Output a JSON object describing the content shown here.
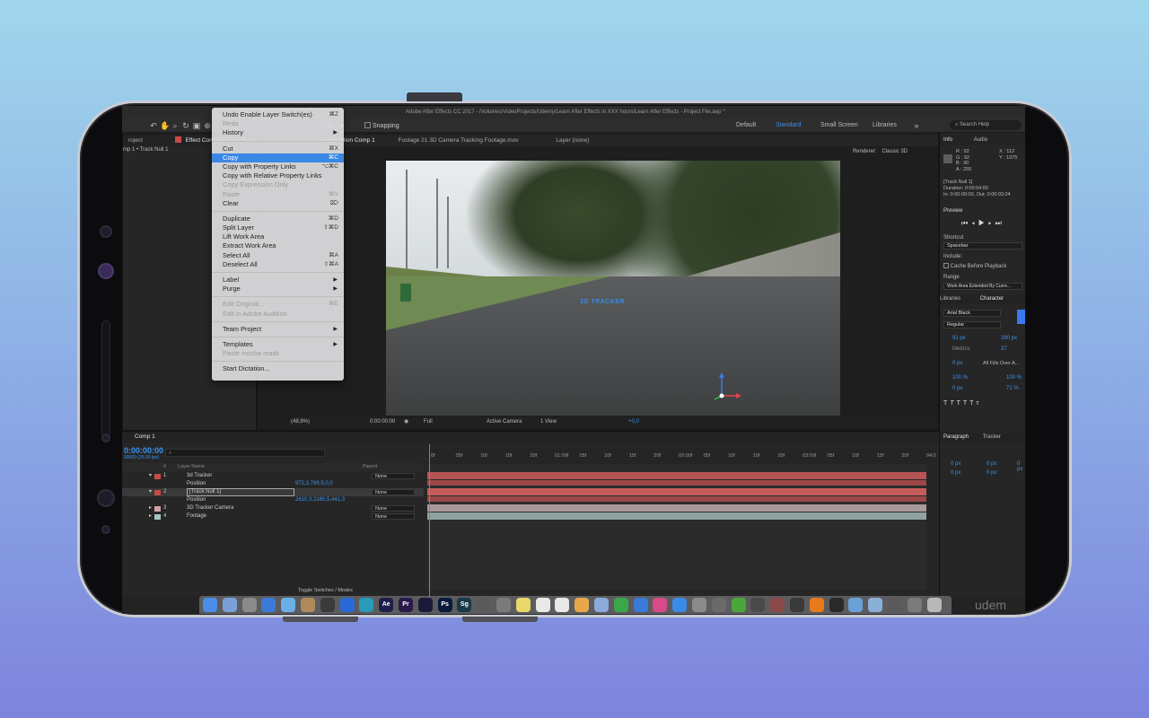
{
  "app": {
    "title": "Adobe After Effects CC 2017 - /Volumes/VideoProjects/Udemy/Learn After Effects in XXX hours/Learn After Effects - Project File.aep *"
  },
  "toolbar": {
    "snapping_label": "Snapping",
    "workspaces": [
      "Default",
      "Standard",
      "Small Screen",
      "Libraries"
    ],
    "active_workspace": "Standard",
    "search_placeholder": "Search Help"
  },
  "panels": {
    "project_tab": "roject",
    "effect_controls_tab": "Effect Controls Track Null 1",
    "composition_tab": "Composition Comp 1",
    "footage_tab": "Footage 21 3D Camera Tracking Footage.mov",
    "layer_tab": "Layer (none)",
    "breadcrumb": "mp 1 • Track Null 1",
    "renderer_label": "Renderer:",
    "renderer_value": "Classic 3D"
  },
  "edit_menu": {
    "items": [
      {
        "label": "Undo Enable Layer Switch(es)",
        "shortcut": "⌘Z",
        "state": "normal"
      },
      {
        "label": "Redo",
        "shortcut": "",
        "state": "disabled"
      },
      {
        "label": "History",
        "shortcut": "",
        "state": "submenu"
      },
      {
        "sep": true
      },
      {
        "label": "Cut",
        "shortcut": "⌘X",
        "state": "normal"
      },
      {
        "label": "Copy",
        "shortcut": "⌘C",
        "state": "highlighted"
      },
      {
        "label": "Copy with Property Links",
        "shortcut": "⌥⌘C",
        "state": "normal"
      },
      {
        "label": "Copy with Relative Property Links",
        "shortcut": "",
        "state": "normal"
      },
      {
        "label": "Copy Expression Only",
        "shortcut": "",
        "state": "disabled"
      },
      {
        "label": "Paste",
        "shortcut": "⌘V",
        "state": "disabled"
      },
      {
        "label": "Clear",
        "shortcut": "⌦",
        "state": "normal"
      },
      {
        "sep": true
      },
      {
        "label": "Duplicate",
        "shortcut": "⌘D",
        "state": "normal"
      },
      {
        "label": "Split Layer",
        "shortcut": "⇧⌘D",
        "state": "normal"
      },
      {
        "label": "Lift Work Area",
        "shortcut": "",
        "state": "normal"
      },
      {
        "label": "Extract Work Area",
        "shortcut": "",
        "state": "normal"
      },
      {
        "label": "Select All",
        "shortcut": "⌘A",
        "state": "normal"
      },
      {
        "label": "Deselect All",
        "shortcut": "⇧⌘A",
        "state": "normal"
      },
      {
        "sep": true
      },
      {
        "label": "Label",
        "shortcut": "",
        "state": "submenu"
      },
      {
        "label": "Purge",
        "shortcut": "",
        "state": "submenu"
      },
      {
        "sep": true
      },
      {
        "label": "Edit Original...",
        "shortcut": "⌘E",
        "state": "disabled"
      },
      {
        "label": "Edit in Adobe Audition",
        "shortcut": "",
        "state": "disabled"
      },
      {
        "sep": true
      },
      {
        "label": "Team Project",
        "shortcut": "",
        "state": "submenu"
      },
      {
        "sep": true
      },
      {
        "label": "Templates",
        "shortcut": "",
        "state": "submenu"
      },
      {
        "label": "Paste mocha mask",
        "shortcut": "",
        "state": "disabled"
      },
      {
        "sep": true
      },
      {
        "label": "Start Dictation...",
        "shortcut": "",
        "state": "normal"
      }
    ]
  },
  "viewer": {
    "overlay_text": "3D TRACKER",
    "zoom": "(48,9%)",
    "timecode": "0:00:00:00",
    "resolution": "Full",
    "camera": "Active Camera",
    "views": "1 View",
    "exposure": "+0,0"
  },
  "timeline": {
    "tab": "Comp 1",
    "time": "0:00:00:00",
    "fps": "00000 (25.00 fps)",
    "columns": {
      "layer_name": "Layer Name",
      "parent": "Parent",
      "number": "#"
    },
    "layers": [
      {
        "num": "1",
        "name": "3d Tracker",
        "prop": "Position",
        "prop_value": "972,3,789,5,0,0",
        "parent": "None",
        "color": "#c84a4a"
      },
      {
        "num": "2",
        "name": "[Track Null 1]",
        "prop": "Position",
        "prop_value": "2610,3,2160,5,441,3",
        "parent": "None",
        "color": "#c84a4a"
      },
      {
        "num": "3",
        "name": "3D Tracker Camera",
        "prop": "",
        "prop_value": "",
        "parent": "None",
        "color": "#d6a0a8"
      },
      {
        "num": "4",
        "name": "Footage",
        "prop": "",
        "prop_value": "",
        "parent": "None",
        "color": "#a6c7c4"
      }
    ],
    "ruler_labels": [
      "0f",
      "05f",
      "10f",
      "15f",
      "20f",
      "01:00f",
      "05f",
      "10f",
      "15f",
      "20f",
      "02:00f",
      "05f",
      "10f",
      "15f",
      "20f",
      "03:00f",
      "05f",
      "10f",
      "15f",
      "20f",
      "04:0"
    ],
    "toggle_label": "Toggle Switches / Modes"
  },
  "info_panel": {
    "tabs": [
      "Info",
      "Audio"
    ],
    "r": "R : 92",
    "g": "G : 92",
    "b": "B : 90",
    "a": "A : 255",
    "x": "X : 112",
    "y": "Y : 1075",
    "layer": "[Track Null 1]",
    "duration": "Duration: 0:00:04:00",
    "in_out": "In: 0:00:00:00, Out: 0:00:03:24"
  },
  "preview_panel": {
    "title": "Preview",
    "shortcut_label": "Shortcut",
    "shortcut_value": "Spacebar",
    "include_label": "Include:",
    "cache_label": "Cache Before Playback",
    "range_label": "Range",
    "range_value": "Work Area Extended By Curre..."
  },
  "character_panel": {
    "tabs": [
      "Libraries",
      "Character"
    ],
    "font": "Arial Black",
    "style": "Regular",
    "size": "91 px",
    "leading": "280 px",
    "kerning": "Metrics",
    "tracking": "37",
    "stroke": "0 px",
    "stroke_mode": "All Fills Over A...",
    "vscale": "100 %",
    "hscale": "100 %",
    "baseline": "0 px",
    "tsume": "71 %"
  },
  "paragraph_panel": {
    "tabs": [
      "Paragraph",
      "Tracker"
    ],
    "values": [
      "0 px",
      "0 px",
      "0 px",
      "0 px",
      "0 px"
    ]
  },
  "dock": {
    "watermark": "udem"
  },
  "colors": {
    "accent": "#3a87e6",
    "timecode_blue": "#3a94f0",
    "layer_red": "#c84a4a"
  }
}
